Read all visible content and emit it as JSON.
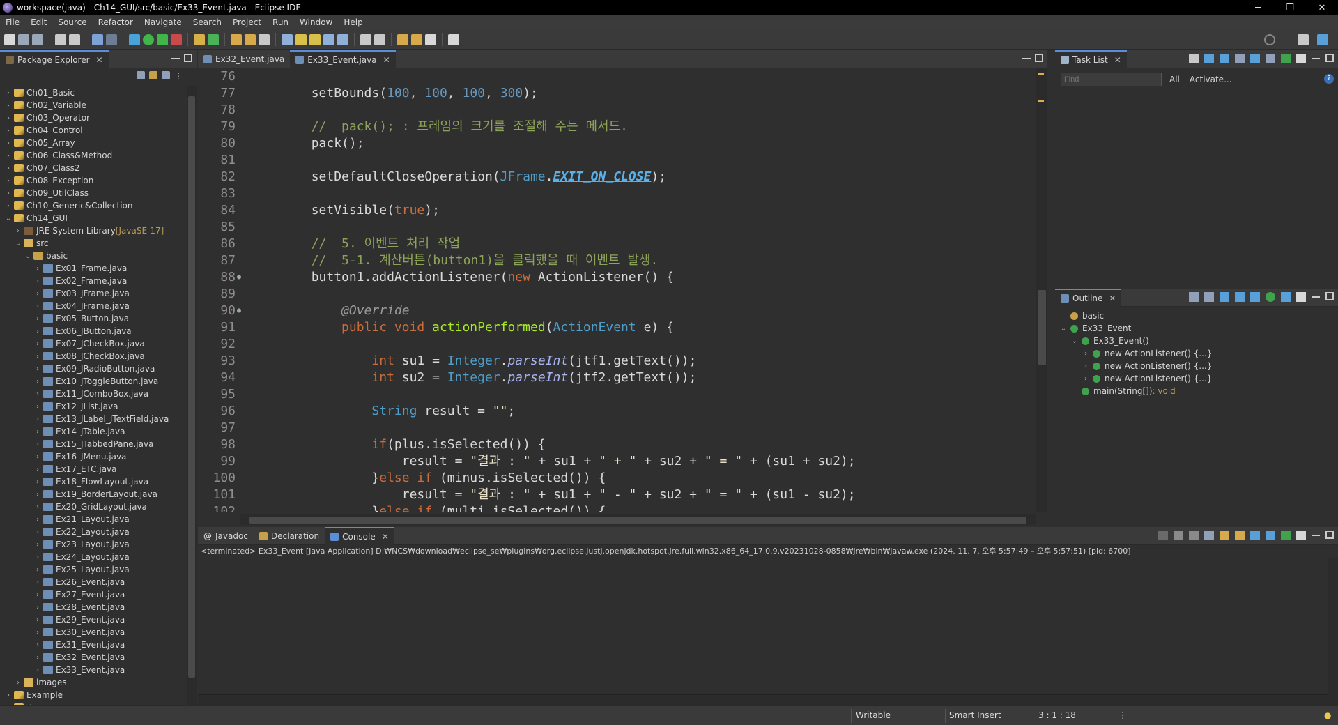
{
  "window": {
    "title": "workspace(java) - Ch14_GUI/src/basic/Ex33_Event.java - Eclipse IDE",
    "minimize": "─",
    "maximize": "❐",
    "close": "✕"
  },
  "menu": [
    "File",
    "Edit",
    "Source",
    "Refactor",
    "Navigate",
    "Search",
    "Project",
    "Run",
    "Window",
    "Help"
  ],
  "package_explorer": {
    "tab_label": "Package Explorer",
    "items": [
      {
        "label": "Ch01_Basic",
        "indent": 0,
        "kind": "proj",
        "chev": "›"
      },
      {
        "label": "Ch02_Variable",
        "indent": 0,
        "kind": "proj",
        "chev": "›"
      },
      {
        "label": "Ch03_Operator",
        "indent": 0,
        "kind": "proj",
        "chev": "›"
      },
      {
        "label": "Ch04_Control",
        "indent": 0,
        "kind": "proj",
        "chev": "›"
      },
      {
        "label": "Ch05_Array",
        "indent": 0,
        "kind": "proj",
        "chev": "›"
      },
      {
        "label": "Ch06_Class&Method",
        "indent": 0,
        "kind": "proj",
        "chev": "›"
      },
      {
        "label": "Ch07_Class2",
        "indent": 0,
        "kind": "proj",
        "chev": "›"
      },
      {
        "label": "Ch08_Exception",
        "indent": 0,
        "kind": "proj",
        "chev": "›"
      },
      {
        "label": "Ch09_UtilClass",
        "indent": 0,
        "kind": "proj",
        "chev": "›"
      },
      {
        "label": "Ch10_Generic&Collection",
        "indent": 0,
        "kind": "proj",
        "chev": "›"
      },
      {
        "label": "Ch14_GUI",
        "indent": 0,
        "kind": "proj",
        "chev": "⌄"
      },
      {
        "label": "JRE System Library",
        "suffix": " [JavaSE-17]",
        "indent": 1,
        "kind": "lib",
        "chev": "›"
      },
      {
        "label": "src",
        "indent": 1,
        "kind": "folder",
        "chev": "⌄"
      },
      {
        "label": "basic",
        "indent": 2,
        "kind": "pkg",
        "chev": "⌄"
      },
      {
        "label": "Ex01_Frame.java",
        "indent": 3,
        "kind": "java",
        "chev": "›"
      },
      {
        "label": "Ex02_Frame.java",
        "indent": 3,
        "kind": "java",
        "chev": "›"
      },
      {
        "label": "Ex03_JFrame.java",
        "indent": 3,
        "kind": "java",
        "chev": "›"
      },
      {
        "label": "Ex04_JFrame.java",
        "indent": 3,
        "kind": "java",
        "chev": "›"
      },
      {
        "label": "Ex05_Button.java",
        "indent": 3,
        "kind": "java",
        "chev": "›"
      },
      {
        "label": "Ex06_JButton.java",
        "indent": 3,
        "kind": "java",
        "chev": "›"
      },
      {
        "label": "Ex07_JCheckBox.java",
        "indent": 3,
        "kind": "java",
        "chev": "›"
      },
      {
        "label": "Ex08_JCheckBox.java",
        "indent": 3,
        "kind": "java",
        "chev": "›"
      },
      {
        "label": "Ex09_JRadioButton.java",
        "indent": 3,
        "kind": "java",
        "chev": "›"
      },
      {
        "label": "Ex10_JToggleButton.java",
        "indent": 3,
        "kind": "java",
        "chev": "›"
      },
      {
        "label": "Ex11_JComboBox.java",
        "indent": 3,
        "kind": "java",
        "chev": "›"
      },
      {
        "label": "Ex12_JList.java",
        "indent": 3,
        "kind": "java",
        "chev": "›"
      },
      {
        "label": "Ex13_JLabel_JTextField.java",
        "indent": 3,
        "kind": "java",
        "chev": "›"
      },
      {
        "label": "Ex14_JTable.java",
        "indent": 3,
        "kind": "java",
        "chev": "›"
      },
      {
        "label": "Ex15_JTabbedPane.java",
        "indent": 3,
        "kind": "java",
        "chev": "›"
      },
      {
        "label": "Ex16_JMenu.java",
        "indent": 3,
        "kind": "java",
        "chev": "›"
      },
      {
        "label": "Ex17_ETC.java",
        "indent": 3,
        "kind": "java",
        "chev": "›"
      },
      {
        "label": "Ex18_FlowLayout.java",
        "indent": 3,
        "kind": "java",
        "chev": "›"
      },
      {
        "label": "Ex19_BorderLayout.java",
        "indent": 3,
        "kind": "java",
        "chev": "›"
      },
      {
        "label": "Ex20_GridLayout.java",
        "indent": 3,
        "kind": "java",
        "chev": "›"
      },
      {
        "label": "Ex21_Layout.java",
        "indent": 3,
        "kind": "java",
        "chev": "›"
      },
      {
        "label": "Ex22_Layout.java",
        "indent": 3,
        "kind": "java",
        "chev": "›"
      },
      {
        "label": "Ex23_Layout.java",
        "indent": 3,
        "kind": "java",
        "chev": "›"
      },
      {
        "label": "Ex24_Layout.java",
        "indent": 3,
        "kind": "java",
        "chev": "›"
      },
      {
        "label": "Ex25_Layout.java",
        "indent": 3,
        "kind": "java",
        "chev": "›"
      },
      {
        "label": "Ex26_Event.java",
        "indent": 3,
        "kind": "java",
        "chev": "›"
      },
      {
        "label": "Ex27_Event.java",
        "indent": 3,
        "kind": "java",
        "chev": "›"
      },
      {
        "label": "Ex28_Event.java",
        "indent": 3,
        "kind": "java",
        "chev": "›"
      },
      {
        "label": "Ex29_Event.java",
        "indent": 3,
        "kind": "java",
        "chev": "›"
      },
      {
        "label": "Ex30_Event.java",
        "indent": 3,
        "kind": "java",
        "chev": "›"
      },
      {
        "label": "Ex31_Event.java",
        "indent": 3,
        "kind": "java",
        "chev": "›"
      },
      {
        "label": "Ex32_Event.java",
        "indent": 3,
        "kind": "java",
        "chev": "›"
      },
      {
        "label": "Ex33_Event.java",
        "indent": 3,
        "kind": "java",
        "chev": "›"
      },
      {
        "label": "images",
        "indent": 1,
        "kind": "folder",
        "chev": "›"
      },
      {
        "label": "Example",
        "indent": 0,
        "kind": "proj",
        "chev": "›"
      },
      {
        "label": "소스",
        "indent": 0,
        "kind": "proj",
        "chev": "›"
      }
    ]
  },
  "editor": {
    "tabs": [
      {
        "label": "Ex32_Event.java",
        "active": false
      },
      {
        "label": "Ex33_Event.java",
        "active": true
      }
    ],
    "lines": [
      {
        "n": "76",
        "m": "",
        "h": ""
      },
      {
        "n": "77",
        "m": "",
        "h": "        setBounds(<span class='num'>100</span>, <span class='num'>100</span>, <span class='num'>100</span>, <span class='num'>300</span>);"
      },
      {
        "n": "78",
        "m": "",
        "h": ""
      },
      {
        "n": "79",
        "m": "",
        "h": "        <span class='cm'>//  pack(); : 프레임의 크기를 조절해 주는 메서드.</span>"
      },
      {
        "n": "80",
        "m": "",
        "h": "        pack();"
      },
      {
        "n": "81",
        "m": "",
        "h": ""
      },
      {
        "n": "82",
        "m": "",
        "h": "        setDefaultCloseOperation(<span class='typ'>JFrame</span>.<span class='cst'>EXIT_ON_CLOSE</span>);"
      },
      {
        "n": "83",
        "m": "",
        "h": ""
      },
      {
        "n": "84",
        "m": "",
        "h": "        setVisible(<span class='kw'>true</span>);"
      },
      {
        "n": "85",
        "m": "",
        "h": ""
      },
      {
        "n": "86",
        "m": "",
        "h": "        <span class='cm'>//  5. 이벤트 처리 작업</span>"
      },
      {
        "n": "87",
        "m": "",
        "h": "        <span class='cm'>//  5-1. 계산버튼(button1)을 클릭했을 때 이벤트 발생.</span>"
      },
      {
        "n": "88",
        "m": "●",
        "h": "        button1.addActionListener(<span class='kw'>new</span> ActionListener() {"
      },
      {
        "n": "89",
        "m": "",
        "h": ""
      },
      {
        "n": "90",
        "m": "●",
        "h": "            <span class='ann'>@Override</span>"
      },
      {
        "n": "91",
        "m": "",
        "h": "            <span class='kw'>public void</span> <span class='mth'>actionPerformed</span>(<span class='typ'>ActionEvent</span> e) {"
      },
      {
        "n": "92",
        "m": "",
        "h": ""
      },
      {
        "n": "93",
        "m": "",
        "h": "                <span class='kw'>int</span> su1 = <span class='typ'>Integer</span>.<span class='sm'>parseInt</span>(jtf1.getText());"
      },
      {
        "n": "94",
        "m": "",
        "h": "                <span class='kw'>int</span> su2 = <span class='typ'>Integer</span>.<span class='sm'>parseInt</span>(jtf2.getText());"
      },
      {
        "n": "95",
        "m": "",
        "h": ""
      },
      {
        "n": "96",
        "m": "",
        "h": "                <span class='typ'>String</span> result = <span class='str'>\"\"</span>;"
      },
      {
        "n": "97",
        "m": "",
        "h": ""
      },
      {
        "n": "98",
        "m": "",
        "h": "                <span class='kw'>if</span>(plus.isSelected()) {"
      },
      {
        "n": "99",
        "m": "",
        "h": "                    result = <span class='str'>\"결과 : \"</span> + su1 + <span class='str'>\" + \"</span> + su2 + <span class='str'>\" = \"</span> + (su1 + su2);"
      },
      {
        "n": "100",
        "m": "",
        "h": "                }<span class='kw'>else if</span> (minus.isSelected()) {"
      },
      {
        "n": "101",
        "m": "",
        "h": "                    result = <span class='str'>\"결과 : \"</span> + su1 + <span class='str'>\" - \"</span> + su2 + <span class='str'>\" = \"</span> + (su1 - su2);"
      },
      {
        "n": "102",
        "m": "",
        "h": "                }<span class='kw'>else if</span> (multi.isSelected()) {"
      }
    ]
  },
  "task_list": {
    "tab_label": "Task List",
    "find_placeholder": "Find",
    "all_label": "All",
    "activate_label": "Activate..."
  },
  "outline": {
    "tab_label": "Outline",
    "items": [
      {
        "label": "basic",
        "indent": 0,
        "chev": "",
        "icon": "#c9a14a"
      },
      {
        "label": "Ex33_Event",
        "indent": 0,
        "chev": "⌄",
        "icon": "#3fa34d"
      },
      {
        "label": "Ex33_Event()",
        "indent": 1,
        "chev": "⌄",
        "icon": "#3fa34d"
      },
      {
        "label": "new ActionListener() {...}",
        "indent": 2,
        "chev": "›",
        "icon": "#3fa34d"
      },
      {
        "label": "new ActionListener() {...}",
        "indent": 2,
        "chev": "›",
        "icon": "#3fa34d"
      },
      {
        "label": "new ActionListener() {...}",
        "indent": 2,
        "chev": "›",
        "icon": "#3fa34d"
      },
      {
        "label": "main(String[])",
        "suffix": " : void",
        "indent": 1,
        "chev": "",
        "icon": "#3fa34d"
      }
    ]
  },
  "console": {
    "tabs": [
      "Javadoc",
      "Declaration",
      "Console"
    ],
    "terminated": "<terminated> Ex33_Event [Java Application] D:₩NCS₩download₩eclipse_se₩plugins₩org.eclipse.justj.openjdk.hotspot.jre.full.win32.x86_64_17.0.9.v20231028-0858₩jre₩bin₩javaw.exe  (2024. 11. 7. 오후 5:57:49 – 오후 5:57:51) [pid: 6700]"
  },
  "status": {
    "writable": "Writable",
    "insert_mode": "Smart Insert",
    "position": "3 : 1 : 18"
  }
}
